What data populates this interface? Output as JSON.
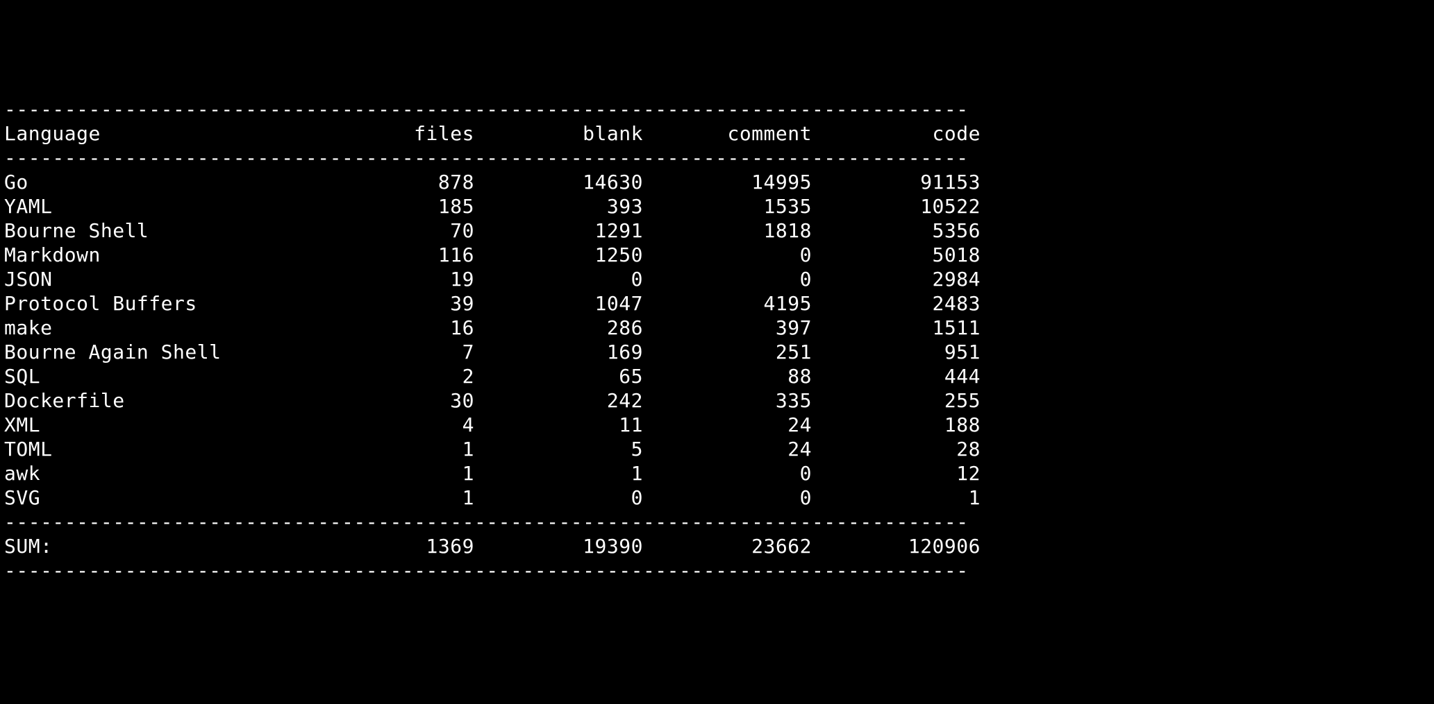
{
  "columns": {
    "language": "Language",
    "files": "files",
    "blank": "blank",
    "comment": "comment",
    "code": "code"
  },
  "rows": [
    {
      "language": "Go",
      "files": 878,
      "blank": 14630,
      "comment": 14995,
      "code": 91153
    },
    {
      "language": "YAML",
      "files": 185,
      "blank": 393,
      "comment": 1535,
      "code": 10522
    },
    {
      "language": "Bourne Shell",
      "files": 70,
      "blank": 1291,
      "comment": 1818,
      "code": 5356
    },
    {
      "language": "Markdown",
      "files": 116,
      "blank": 1250,
      "comment": 0,
      "code": 5018
    },
    {
      "language": "JSON",
      "files": 19,
      "blank": 0,
      "comment": 0,
      "code": 2984
    },
    {
      "language": "Protocol Buffers",
      "files": 39,
      "blank": 1047,
      "comment": 4195,
      "code": 2483
    },
    {
      "language": "make",
      "files": 16,
      "blank": 286,
      "comment": 397,
      "code": 1511
    },
    {
      "language": "Bourne Again Shell",
      "files": 7,
      "blank": 169,
      "comment": 251,
      "code": 951
    },
    {
      "language": "SQL",
      "files": 2,
      "blank": 65,
      "comment": 88,
      "code": 444
    },
    {
      "language": "Dockerfile",
      "files": 30,
      "blank": 242,
      "comment": 335,
      "code": 255
    },
    {
      "language": "XML",
      "files": 4,
      "blank": 11,
      "comment": 24,
      "code": 188
    },
    {
      "language": "TOML",
      "files": 1,
      "blank": 5,
      "comment": 24,
      "code": 28
    },
    {
      "language": "awk",
      "files": 1,
      "blank": 1,
      "comment": 0,
      "code": 12
    },
    {
      "language": "SVG",
      "files": 1,
      "blank": 0,
      "comment": 0,
      "code": 1
    }
  ],
  "sum_label": "SUM:",
  "sum": {
    "files": 1369,
    "blank": 19390,
    "comment": 23662,
    "code": 120906
  },
  "layout": {
    "total_width": 80,
    "lang_width": 25,
    "num_width": 14
  },
  "chart_data": {
    "type": "table",
    "title": "",
    "columns": [
      "Language",
      "files",
      "blank",
      "comment",
      "code"
    ],
    "rows": [
      [
        "Go",
        878,
        14630,
        14995,
        91153
      ],
      [
        "YAML",
        185,
        393,
        1535,
        10522
      ],
      [
        "Bourne Shell",
        70,
        1291,
        1818,
        5356
      ],
      [
        "Markdown",
        116,
        1250,
        0,
        5018
      ],
      [
        "JSON",
        19,
        0,
        0,
        2984
      ],
      [
        "Protocol Buffers",
        39,
        1047,
        4195,
        2483
      ],
      [
        "make",
        16,
        286,
        397,
        1511
      ],
      [
        "Bourne Again Shell",
        7,
        169,
        251,
        951
      ],
      [
        "SQL",
        2,
        65,
        88,
        444
      ],
      [
        "Dockerfile",
        30,
        242,
        335,
        255
      ],
      [
        "XML",
        4,
        11,
        24,
        188
      ],
      [
        "TOML",
        1,
        5,
        24,
        28
      ],
      [
        "awk",
        1,
        1,
        0,
        12
      ],
      [
        "SVG",
        1,
        0,
        0,
        1
      ]
    ],
    "sum": [
      "SUM:",
      1369,
      19390,
      23662,
      120906
    ]
  }
}
